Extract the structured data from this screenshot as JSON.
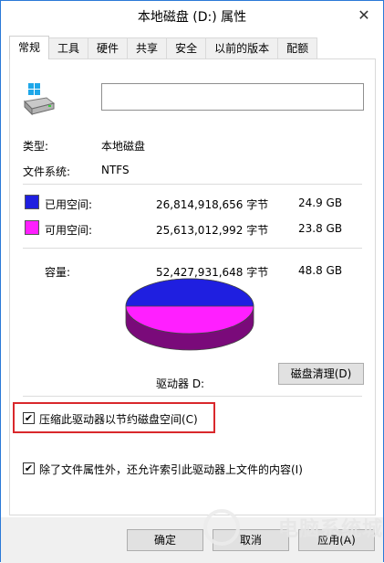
{
  "window": {
    "title": "本地磁盘 (D:) 属性",
    "close_glyph": "✕"
  },
  "tabs": [
    {
      "label": "常规"
    },
    {
      "label": "工具"
    },
    {
      "label": "硬件"
    },
    {
      "label": "共享"
    },
    {
      "label": "安全"
    },
    {
      "label": "以前的版本"
    },
    {
      "label": "配额"
    }
  ],
  "general": {
    "name_value": "",
    "type_label": "类型:",
    "type_value": "本地磁盘",
    "fs_label": "文件系统:",
    "fs_value": "NTFS",
    "used": {
      "label": "已用空间:",
      "bytes": "26,814,918,656 字节",
      "size": "24.9 GB",
      "color": "#1f1fe0"
    },
    "free": {
      "label": "可用空间:",
      "bytes": "25,613,012,992 字节",
      "size": "23.8 GB",
      "color": "#ff1fff"
    },
    "capacity": {
      "label": "容量:",
      "bytes": "52,427,931,648 字节",
      "size": "48.8 GB"
    },
    "drive_label": "驱动器 D:",
    "cleanup_button": "磁盘清理(D)",
    "compress_checkbox": {
      "label": "压缩此驱动器以节约磁盘空间(C)",
      "checked": true
    },
    "index_checkbox": {
      "label": "除了文件属性外，还允许索引此驱动器上文件的内容(I)",
      "checked": true
    }
  },
  "footer": {
    "ok": "确定",
    "cancel": "取消",
    "apply": "应用(A)"
  },
  "watermark": "电脑系统城",
  "icons": {
    "close": "close-icon",
    "drive": "drive-icon",
    "check": "checkmark-icon"
  }
}
